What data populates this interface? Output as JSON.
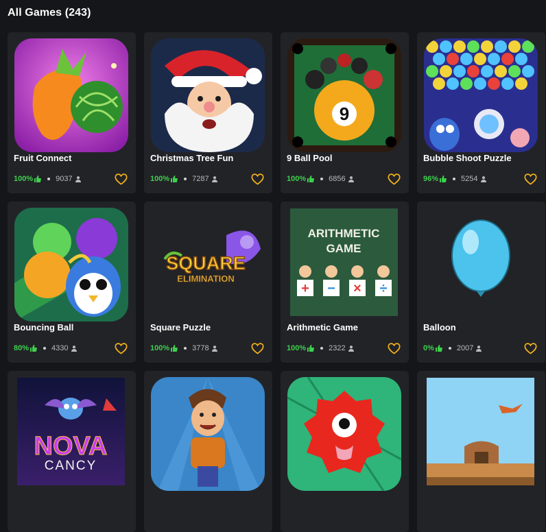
{
  "header": {
    "title": "All Games (243)"
  },
  "games": [
    {
      "title": "Fruit Connect",
      "rating": "100%",
      "plays": "9037"
    },
    {
      "title": "Christmas Tree Fun",
      "rating": "100%",
      "plays": "7287"
    },
    {
      "title": "9 Ball Pool",
      "rating": "100%",
      "plays": "6856"
    },
    {
      "title": "Bubble Shoot Puzzle",
      "rating": "96%",
      "plays": "5254"
    },
    {
      "title": "Bouncing Ball",
      "rating": "80%",
      "plays": "4330"
    },
    {
      "title": "Square Puzzle",
      "rating": "100%",
      "plays": "3778"
    },
    {
      "title": "Arithmetic Game",
      "rating": "100%",
      "plays": "2322"
    },
    {
      "title": "Balloon",
      "rating": "0%",
      "plays": "2007"
    },
    {
      "title": "",
      "rating": "",
      "plays": ""
    },
    {
      "title": "",
      "rating": "",
      "plays": ""
    },
    {
      "title": "",
      "rating": "",
      "plays": ""
    },
    {
      "title": "",
      "rating": "",
      "plays": ""
    }
  ],
  "thumbnail_text": {
    "square": "SQUARE",
    "elimination": "ELIMINATION",
    "arith_line1": "ARITHMETIC",
    "arith_line2": "GAME",
    "arith_symbols": [
      "+",
      "−",
      "×",
      "÷"
    ],
    "nova": "NOVA",
    "cancy": "CANCY",
    "pool_ball": "9"
  },
  "icons": {
    "like": "thumbs-up-icon",
    "plays": "user-icon",
    "favorite": "heart-icon"
  },
  "colors": {
    "accent_green": "#3fcf4e",
    "heart": "#f2b21a",
    "card": "#222327",
    "background": "#151619"
  }
}
